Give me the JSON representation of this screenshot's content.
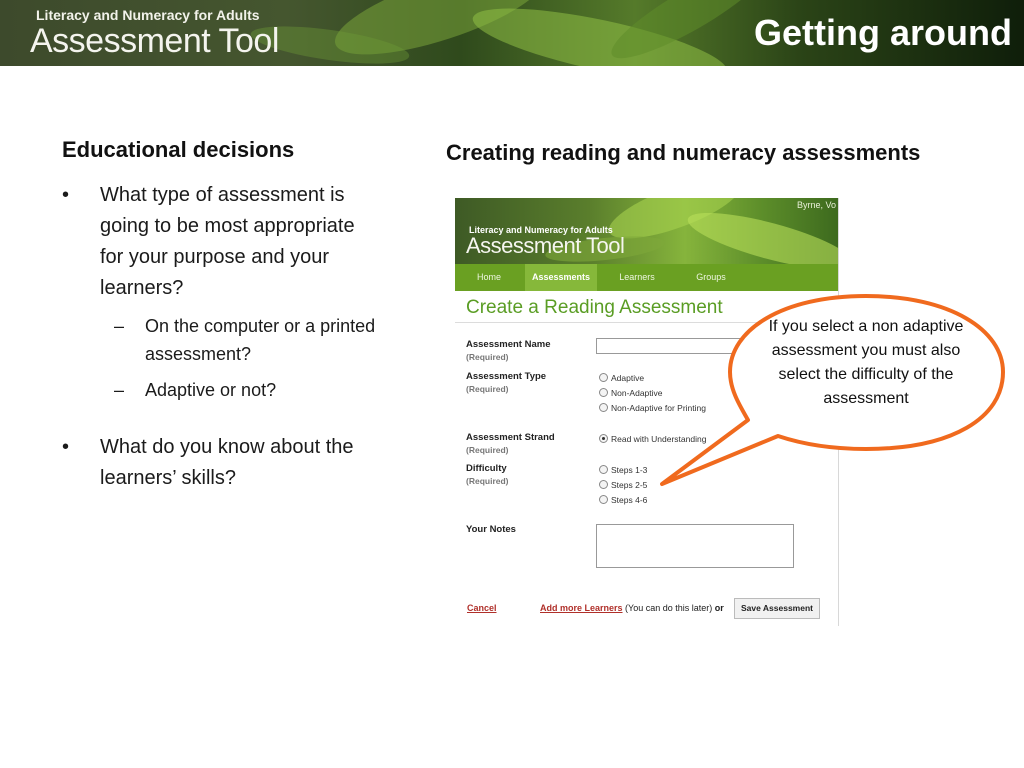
{
  "banner": {
    "subtitle": "Literacy and Numeracy for Adults",
    "title": "Assessment Tool",
    "slide_title": "Getting around"
  },
  "left": {
    "heading": "Educational decisions",
    "bullets": [
      {
        "text": "What type of assessment is going to be most appropriate for your purpose and your learners?",
        "subs": [
          "On the computer or a printed assessment?",
          "Adaptive or not?"
        ]
      },
      {
        "text": "What do you know about the learners’ skills?",
        "subs": []
      }
    ],
    "bullet_glyph": "•",
    "sub_glyph": "–"
  },
  "right": {
    "heading": "Creating reading and numeracy assessments"
  },
  "screenshot": {
    "user_label": "Byrne, Vo",
    "banner_subtitle": "Literacy and Numeracy for Adults",
    "banner_title": "Assessment Tool",
    "nav": [
      "Home",
      "Assessments",
      "Learners",
      "Groups"
    ],
    "active_tab": "Assessments",
    "page_heading": "Create a Reading Assessment",
    "form": {
      "name_label": "Assessment Name",
      "type_label": "Assessment Type",
      "strand_label": "Assessment Strand",
      "difficulty_label": "Difficulty",
      "notes_label": "Your Notes",
      "required": "(Required)",
      "type_options": [
        "Adaptive",
        "Non-Adaptive",
        "Non-Adaptive for Printing"
      ],
      "strand_options": [
        "Read with Understanding"
      ],
      "strand_selected": "Read with Understanding",
      "difficulty_options": [
        "Steps 1-3",
        "Steps 2-5",
        "Steps 4-6"
      ]
    },
    "footer": {
      "cancel": "Cancel",
      "add_more": "Add more Learners",
      "later_note": "(You can do this later)",
      "or": "or",
      "save": "Save Assessment"
    }
  },
  "callout": {
    "text": "If you select a non adaptive assessment you must also select the difficulty of the assessment",
    "stroke_color": "#f06a1e"
  }
}
